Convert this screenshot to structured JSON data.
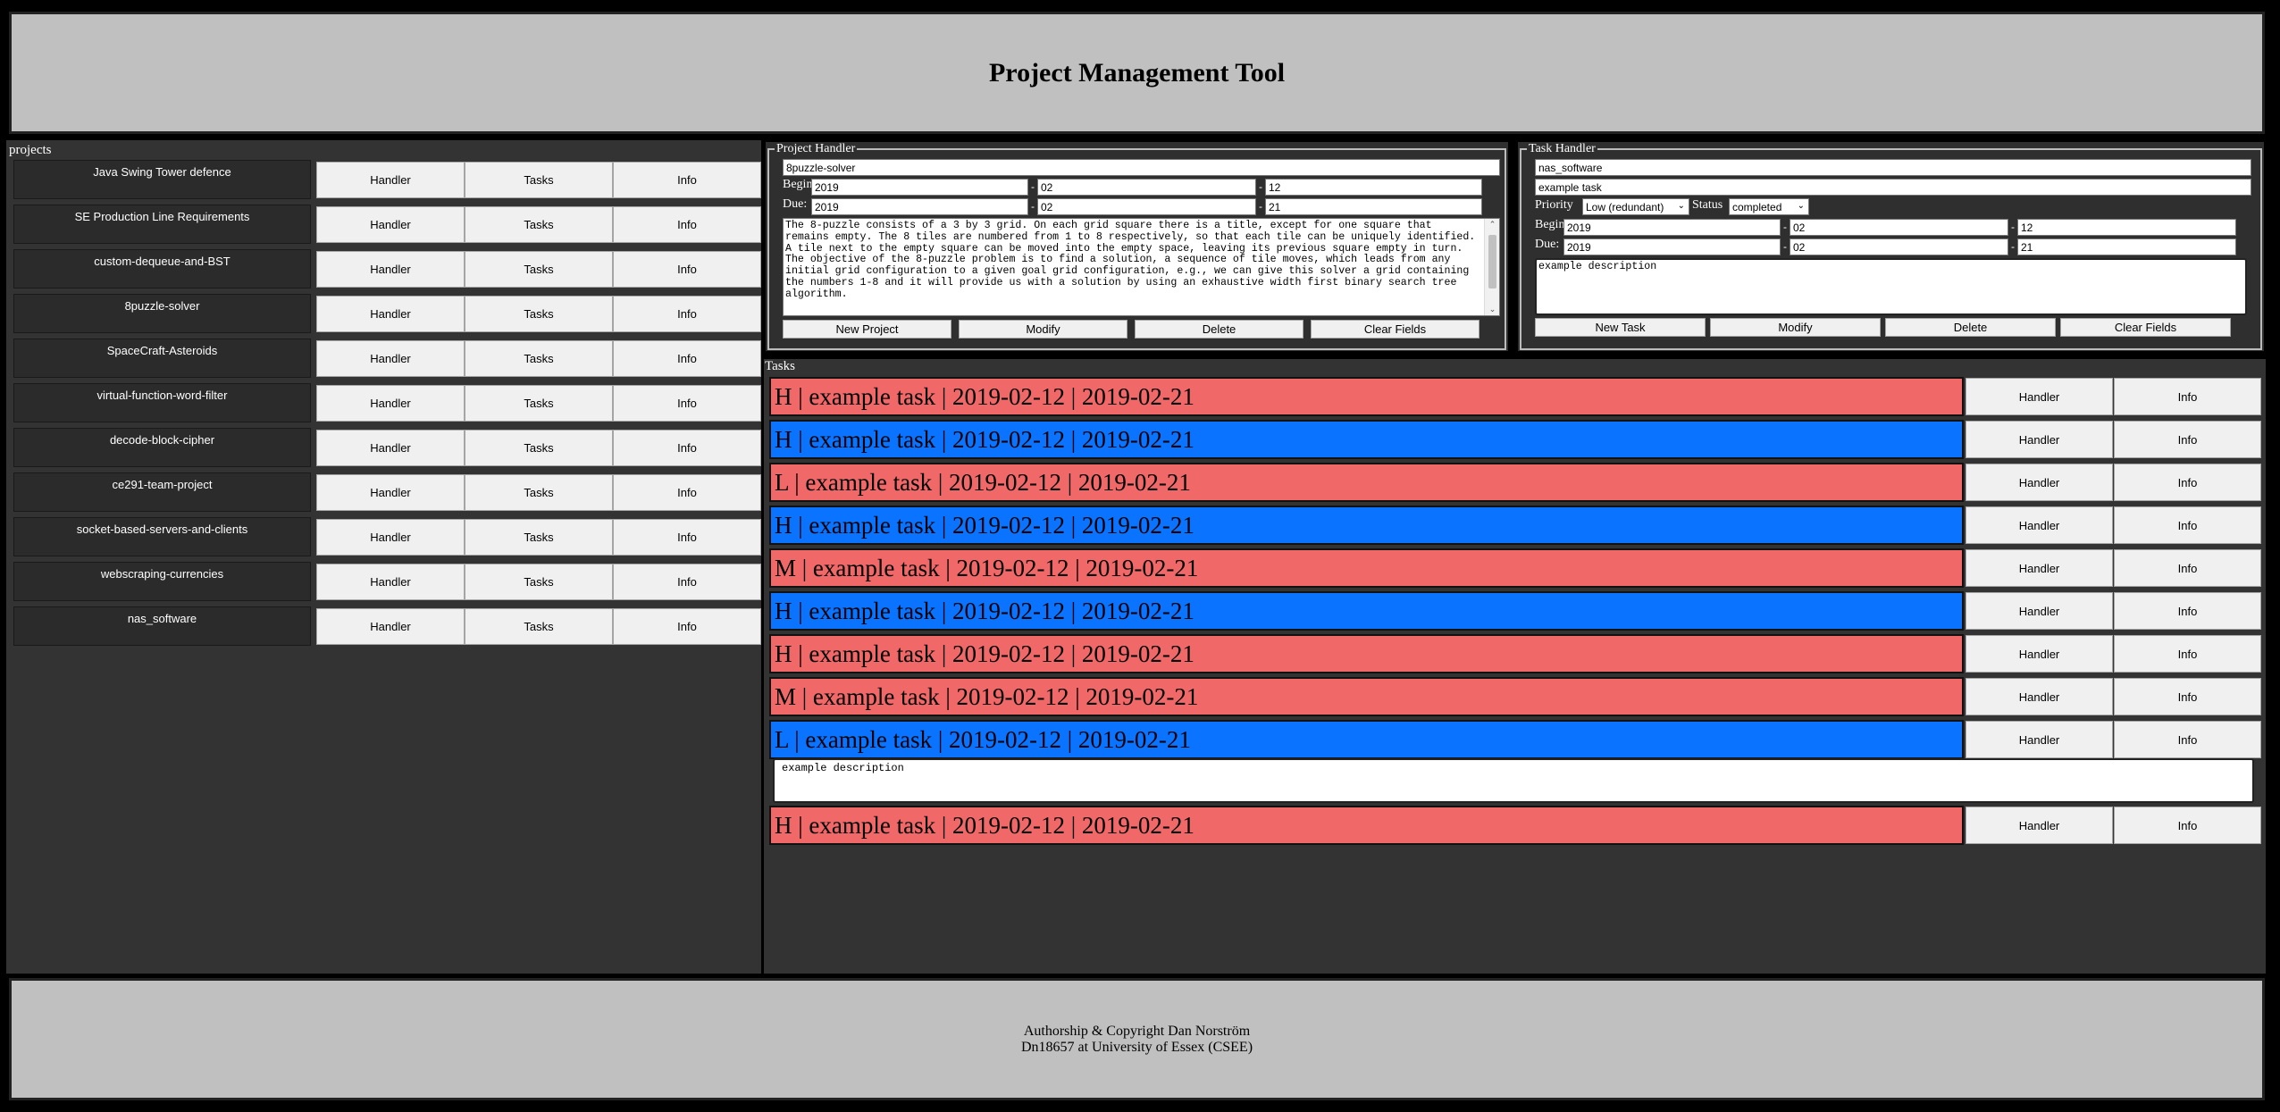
{
  "header": {
    "title": "Project Management Tool"
  },
  "footer": {
    "line1": "Authorship & Copyright Dan Norström",
    "line2": "Dn18657 at University of Essex (CSEE)"
  },
  "colors": {
    "high_priority": "#f06868",
    "alt_row": "#0a73ff",
    "panel": "#333333",
    "button": "#f0f0f0"
  },
  "projects": {
    "legend": "projects",
    "items": [
      {
        "name": "Java Swing Tower defence",
        "handler": "Handler",
        "tasks": "Tasks",
        "info": "Info"
      },
      {
        "name": "SE Production Line Requirements",
        "handler": "Handler",
        "tasks": "Tasks",
        "info": "Info"
      },
      {
        "name": "custom-dequeue-and-BST",
        "handler": "Handler",
        "tasks": "Tasks",
        "info": "Info"
      },
      {
        "name": "8puzzle-solver",
        "handler": "Handler",
        "tasks": "Tasks",
        "info": "Info"
      },
      {
        "name": "SpaceCraft-Asteroids",
        "handler": "Handler",
        "tasks": "Tasks",
        "info": "Info"
      },
      {
        "name": "virtual-function-word-filter",
        "handler": "Handler",
        "tasks": "Tasks",
        "info": "Info"
      },
      {
        "name": "decode-block-cipher",
        "handler": "Handler",
        "tasks": "Tasks",
        "info": "Info"
      },
      {
        "name": "ce291-team-project",
        "handler": "Handler",
        "tasks": "Tasks",
        "info": "Info"
      },
      {
        "name": "socket-based-servers-and-clients",
        "handler": "Handler",
        "tasks": "Tasks",
        "info": "Info"
      },
      {
        "name": "webscraping-currencies",
        "handler": "Handler",
        "tasks": "Tasks",
        "info": "Info"
      },
      {
        "name": "nas_software",
        "handler": "Handler",
        "tasks": "Tasks",
        "info": "Info"
      }
    ]
  },
  "project_handler": {
    "legend": "Project Handler",
    "name_value": "8puzzle-solver",
    "begin_label": "Begin:",
    "due_label": "Due:",
    "dash": "-",
    "begin": {
      "year": "2019",
      "month": "02",
      "day": "12"
    },
    "due": {
      "year": "2019",
      "month": "02",
      "day": "21"
    },
    "description": "The 8-puzzle consists of a 3 by 3 grid. On each grid square there is a title, except for one square that remains empty. The 8 tiles are numbered from 1 to 8 respectively, so that each tile can be uniquely identified. A tile next to the empty square can be moved into the empty space, leaving its previous square empty in turn. The objective of the 8-puzzle problem is to find a solution, a sequence of tile moves, which leads from any initial grid configuration to a given goal grid configuration, e.g., we can give this solver a grid containing the numbers 1-8 and it will provide us with a solution by using an exhaustive width first binary search tree algorithm.",
    "buttons": {
      "new": "New Project",
      "modify": "Modify",
      "delete": "Delete",
      "clear": "Clear Fields"
    }
  },
  "task_handler": {
    "legend": "Task Handler",
    "project_value": "nas_software",
    "name_value": "example task",
    "priority_label": "Priority",
    "priority_value": "Low (redundant)",
    "status_label": "Status",
    "status_value": "completed",
    "begin_label": "Begin:",
    "due_label": "Due:",
    "dash": "-",
    "begin": {
      "year": "2019",
      "month": "02",
      "day": "12"
    },
    "due": {
      "year": "2019",
      "month": "02",
      "day": "21"
    },
    "description": "example description",
    "buttons": {
      "new": "New Task",
      "modify": "Modify",
      "delete": "Delete",
      "clear": "Clear Fields"
    }
  },
  "tasks": {
    "legend": "Tasks",
    "items": [
      {
        "text": "H | example task | 2019-02-12 | 2019-02-21",
        "color": "#f06868",
        "handler": "Handler",
        "info": "Info"
      },
      {
        "text": "H | example task | 2019-02-12 | 2019-02-21",
        "color": "#0a73ff",
        "handler": "Handler",
        "info": "Info"
      },
      {
        "text": "L | example task | 2019-02-12 | 2019-02-21",
        "color": "#f06868",
        "handler": "Handler",
        "info": "Info"
      },
      {
        "text": "H | example task | 2019-02-12 | 2019-02-21",
        "color": "#0a73ff",
        "handler": "Handler",
        "info": "Info"
      },
      {
        "text": "M | example task | 2019-02-12 | 2019-02-21",
        "color": "#f06868",
        "handler": "Handler",
        "info": "Info"
      },
      {
        "text": "H | example task | 2019-02-12 | 2019-02-21",
        "color": "#0a73ff",
        "handler": "Handler",
        "info": "Info"
      },
      {
        "text": "H | example task | 2019-02-12 | 2019-02-21",
        "color": "#f06868",
        "handler": "Handler",
        "info": "Info"
      },
      {
        "text": "M | example task | 2019-02-12 | 2019-02-21",
        "color": "#f06868",
        "handler": "Handler",
        "info": "Info"
      },
      {
        "text": "L | example task | 2019-02-12 | 2019-02-21",
        "color": "#0a73ff",
        "handler": "Handler",
        "info": "Info"
      },
      {
        "text": "H | example task | 2019-02-12 | 2019-02-21",
        "color": "#f06868",
        "handler": "Handler",
        "info": "Info"
      }
    ],
    "expanded_description": "example description"
  }
}
